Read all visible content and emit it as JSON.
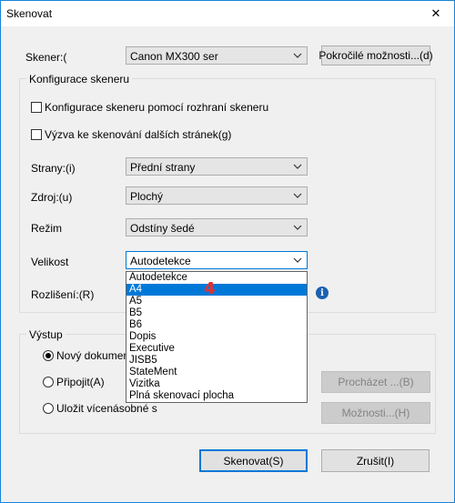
{
  "window": {
    "title": "Skenovat",
    "close_glyph": "✕"
  },
  "scanner": {
    "label": "Skener:(",
    "value": "Canon MX300 ser",
    "advanced_button": "Pokročilé možnosti...(d)"
  },
  "config_group": {
    "title": "Konfigurace skeneru",
    "checkbox1": "Konfigurace skeneru pomocí rozhraní skeneru",
    "checkbox2": "Výzva ke skenování dalších stránek(g)",
    "sides": {
      "label": "Strany:(i)",
      "value": "Přední strany"
    },
    "source": {
      "label": "Zdroj:(u)",
      "value": "Plochý"
    },
    "mode": {
      "label": "Režim",
      "value": "Odstíny šedé"
    },
    "size": {
      "label": "Velikost",
      "value": "Autodetekce"
    },
    "resolution": {
      "label": "Rozlišení:(R)"
    }
  },
  "size_dropdown": {
    "selected_index": 1,
    "items": [
      "Autodetekce",
      "A4",
      "A5",
      "B5",
      "B6",
      "Dopis",
      "Executive",
      "JISB5",
      "StateMent",
      "Vizitka",
      "Plná skenovací plocha"
    ]
  },
  "annotation_badge": "4",
  "output_group": {
    "title": "Výstup",
    "radio1": "Nový dokument",
    "radio2": "Připojit(A)",
    "radio3": "Uložit vícenásobné s",
    "browse_button": "Procházet ...(B)",
    "options_button": "Možnosti...(H)"
  },
  "footer": {
    "scan_button": "Skenovat(S)",
    "cancel_button": "Zrušit(I)"
  },
  "colors": {
    "accent": "#0078d7",
    "selection": "#0078d7",
    "badge": "#e53030",
    "info": "#1c61b0"
  }
}
